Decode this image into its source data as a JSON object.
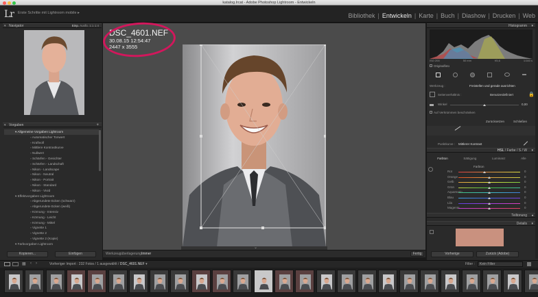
{
  "window": {
    "title": "katalog.lrcat - Adobe Photoshop Lightroom - Entwickeln"
  },
  "identity": {
    "logo": "Lr",
    "catalog": "Erste Schritte mit Lightroom mobile"
  },
  "modules": [
    "Bibliothek",
    "Entwickeln",
    "Karte",
    "Buch",
    "Diashow",
    "Drucken",
    "Web"
  ],
  "left": {
    "navigator": {
      "title": "Navigator",
      "zoom": [
        "Einp.",
        "Ausfü.",
        "1:1",
        "1:4"
      ]
    },
    "presets": {
      "title": "Vorgaben",
      "items": [
        {
          "t": "Allgemeine Vorgaben Lightroom",
          "k": "f"
        },
        {
          "t": "Automatischer Tonwert",
          "k": "p"
        },
        {
          "t": "Kraftvoll",
          "k": "p"
        },
        {
          "t": "Mittlere Kontrastkurve",
          "k": "p"
        },
        {
          "t": "Nullwert",
          "k": "p"
        },
        {
          "t": "Schärfen - Gesichter",
          "k": "p"
        },
        {
          "t": "Schärfen - Landschaft",
          "k": "p"
        },
        {
          "t": "Nikon - Landscape",
          "k": "p"
        },
        {
          "t": "Nikon - Neutral",
          "k": "p"
        },
        {
          "t": "Nikon - Portrait",
          "k": "p"
        },
        {
          "t": "Nikon - Standard",
          "k": "p"
        },
        {
          "t": "Nikon - Vivid",
          "k": "p"
        },
        {
          "t": "Effektvorgaben Lightroom",
          "k": "f"
        },
        {
          "t": "Abgerundete Ecken (schwarz)",
          "k": "p"
        },
        {
          "t": "Abgerundete Ecken (weiß)",
          "k": "p"
        },
        {
          "t": "Körnung - Intensiv",
          "k": "p"
        },
        {
          "t": "Körnung - Leicht",
          "k": "p"
        },
        {
          "t": "Körnung - Mittel",
          "k": "p"
        },
        {
          "t": "Vignette 1",
          "k": "p"
        },
        {
          "t": "Vignette 2",
          "k": "p"
        },
        {
          "t": "Vignette 2 (Kopie)",
          "k": "p"
        },
        {
          "t": "Farbvorgaben Lightroom",
          "k": "f"
        }
      ]
    },
    "copy": "Kopieren...",
    "paste": "Einfügen"
  },
  "center": {
    "filename": "DSC_4601.NEF",
    "datetime": "30.08.15 12:54:47",
    "dimensions": "2447 x 3555",
    "toolbar": {
      "label": "Werkzeugüberlagerung :",
      "value": "Immer",
      "done": "Fertig"
    }
  },
  "right": {
    "histogram": {
      "title": "Histogramm",
      "values": [
        "ISO 200",
        "50 mm",
        "f/5,6",
        "1/160 s"
      ],
      "orig": "Originalfoto"
    },
    "crop": {
      "tool": "Werkzeug :",
      "tool_value": "Freistellen und gerade ausrichten",
      "aspect": "Seitenverhältnis :",
      "aspect_value": "Benutzerdefiniert",
      "angle": "Winkel",
      "angle_value": "0,00",
      "constrain": "Auf Verkrümmen beschränken",
      "reset": "Zurücksetzen",
      "close": "Schließen"
    },
    "curve": {
      "label": "Punktkurve :",
      "value": "Mittlerer Kontrast"
    },
    "hsl": {
      "header": [
        "HSL",
        "Farbe",
        "S / W"
      ],
      "tabs": [
        "Farbton",
        "Sättigung",
        "Luminanz",
        "Alle"
      ],
      "section": "Farbton",
      "sliders": [
        {
          "name": "Rot",
          "value": 0.42
        },
        {
          "name": "Orange",
          "value": 0.5
        },
        {
          "name": "Gelb",
          "value": 0.5
        },
        {
          "name": "Grün",
          "value": 0.5
        },
        {
          "name": "Aquamarin",
          "value": 0.5
        },
        {
          "name": "Blau",
          "value": 0.5
        },
        {
          "name": "Lila",
          "value": 0.5
        },
        {
          "name": "Magenta",
          "value": 0.5
        }
      ]
    },
    "tone": "Teiltonung",
    "details": "Details",
    "prev": "Vorherige",
    "resetbtn": "Zurück (Adobe)"
  },
  "filmbar": {
    "prefix": "Vorheriger Import : 232 Fotos / 1 ausgewählt /",
    "file": "DSC_4601.NEF",
    "filter": "Filter :",
    "filter_value": "Kein Filter"
  },
  "colors": {
    "accent": "#d2175c"
  }
}
